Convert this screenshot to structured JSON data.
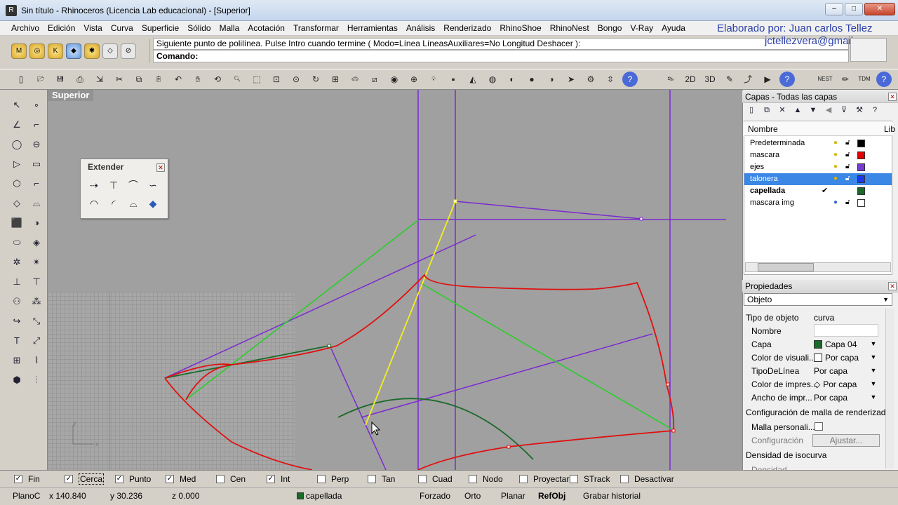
{
  "window": {
    "title": "Sin título - Rhinoceros (Licencia Lab educacional) - [Superior]",
    "buttons": [
      "–",
      "□",
      "✕"
    ]
  },
  "menubar": {
    "items": [
      "Archivo",
      "Edición",
      "Vista",
      "Curva",
      "Superficie",
      "Sólido",
      "Malla",
      "Acotación",
      "Transformar",
      "Herramientas",
      "Análisis",
      "Renderizado",
      "RhinoShoe",
      "RhinoNest",
      "Bongo",
      "V-Ray",
      "Ayuda"
    ]
  },
  "credit": {
    "brand": "Elaborado por: Juan carlos Tellez",
    "email": "jctellezvera@gmail.com"
  },
  "command": {
    "history": "Siguiente punto de polilínea. Pulse Intro cuando termine ( Modo=Línea  LíneasAuxiliares=No  Longitud  Deshacer ):",
    "prompt": "Comando:"
  },
  "viewport": {
    "name": "Superior"
  },
  "extender_panel": {
    "title": "Extender"
  },
  "layers_panel": {
    "title": "Capas - Todas las capas",
    "col_name": "Nombre",
    "col_lib": "Lib",
    "layers": [
      {
        "name": "Predeterminada",
        "color": "#000000"
      },
      {
        "name": "mascara",
        "color": "#e00000"
      },
      {
        "name": "ejes",
        "color": "#7a3ad0"
      },
      {
        "name": "talonera",
        "color": "#1a3ae8"
      },
      {
        "name": "capellada",
        "color": "#1a6a2a"
      },
      {
        "name": "mascara img",
        "color": "#ffffff"
      }
    ]
  },
  "properties_panel": {
    "title": "Propiedades",
    "selector": "Objeto",
    "rows": [
      {
        "label": "Tipo de objeto",
        "value": "curva"
      },
      {
        "label": "Nombre",
        "value": ""
      },
      {
        "label": "Capa",
        "value": "Capa 04"
      },
      {
        "label": "Color de visuali...",
        "value": "Por capa"
      },
      {
        "label": "TipoDeLínea",
        "value": "Por capa"
      },
      {
        "label": "Color de impres...",
        "value": "Por capa"
      },
      {
        "label": "Ancho de impr...",
        "value": "Por capa"
      }
    ],
    "mesh_section": "Configuración de malla de renderizado",
    "custom_mesh": "Malla personali...",
    "config": "Configuración",
    "adjust": "Ajustar...",
    "isocurve": "Densidad de isocurva",
    "isocurve_sub": "Densidad"
  },
  "osnaps": [
    {
      "label": "Fin",
      "checked": true
    },
    {
      "label": "Cerca",
      "checked": true
    },
    {
      "label": "Punto",
      "checked": true
    },
    {
      "label": "Med",
      "checked": true
    },
    {
      "label": "Cen",
      "checked": false
    },
    {
      "label": "Int",
      "checked": true
    },
    {
      "label": "Perp",
      "checked": false
    },
    {
      "label": "Tan",
      "checked": false
    },
    {
      "label": "Cuad",
      "checked": false
    },
    {
      "label": "Nodo",
      "checked": false
    },
    {
      "label": "Proyectar",
      "checked": false
    },
    {
      "label": "STrack",
      "checked": false
    },
    {
      "label": "Desactivar",
      "checked": false
    }
  ],
  "status": {
    "plane": "PlanoC",
    "x": "x 140.840",
    "y": "y 30.236",
    "z": "z 0.000",
    "layer": "capellada",
    "layer_color": "#1a6a2a",
    "modes": [
      "Forzado",
      "Orto",
      "Planar",
      "RefObj",
      "Grabar historial"
    ]
  },
  "colors": {
    "curve_red": "#e01010",
    "curve_purple": "#7a2ad0",
    "curve_green": "#24d024",
    "curve_yellow": "#f2ee20",
    "curve_darkgreen": "#1a6a2a",
    "selection": "#3a87e6"
  }
}
